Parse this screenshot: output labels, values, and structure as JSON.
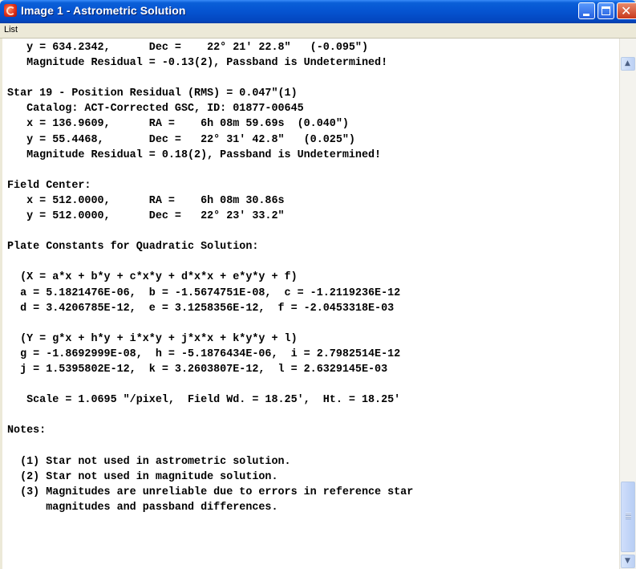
{
  "window": {
    "title": "Image 1 - Astrometric Solution",
    "controls": [
      "minimize",
      "maximize",
      "close"
    ]
  },
  "menu": {
    "list_label": "List"
  },
  "report_lines": [
    "   y = 634.2342,      Dec =    22° 21' 22.8\"   (-0.095\")",
    "   Magnitude Residual = -0.13(2), Passband is Undetermined!",
    "",
    "Star 19 - Position Residual (RMS) = 0.047\"(1)",
    "   Catalog: ACT-Corrected GSC, ID: 01877-00645",
    "   x = 136.9609,      RA =    6h 08m 59.69s  (0.040\")",
    "   y = 55.4468,       Dec =   22° 31' 42.8\"   (0.025\")",
    "   Magnitude Residual = 0.18(2), Passband is Undetermined!",
    "",
    "Field Center:",
    "   x = 512.0000,      RA =    6h 08m 30.86s",
    "   y = 512.0000,      Dec =   22° 23' 33.2\"",
    "",
    "Plate Constants for Quadratic Solution:",
    "",
    "  (X = a*x + b*y + c*x*y + d*x*x + e*y*y + f)",
    "  a = 5.1821476E-06,  b = -1.5674751E-08,  c = -1.2119236E-12",
    "  d = 3.4206785E-12,  e = 3.1258356E-12,  f = -2.0453318E-03",
    "",
    "  (Y = g*x + h*y + i*x*y + j*x*x + k*y*y + l)",
    "  g = -1.8692999E-08,  h = -5.1876434E-06,  i = 2.7982514E-12",
    "  j = 1.5395802E-12,  k = 3.2603807E-12,  l = 2.6329145E-03",
    "",
    "   Scale = 1.0695 \"/pixel,  Field Wd. = 18.25',  Ht. = 18.25'",
    "",
    "Notes:",
    "",
    "  (1) Star not used in astrometric solution.",
    "  (2) Star not used in magnitude solution.",
    "  (3) Magnitudes are unreliable due to errors in reference star",
    "      magnitudes and passband differences."
  ],
  "scrollbar": {
    "up_arrow": "▲",
    "down_arrow": "▼"
  },
  "colors": {
    "title_bar": "#0553d0",
    "close_button": "#c8381c",
    "text_background": "#ffffff",
    "text": "#000000"
  }
}
